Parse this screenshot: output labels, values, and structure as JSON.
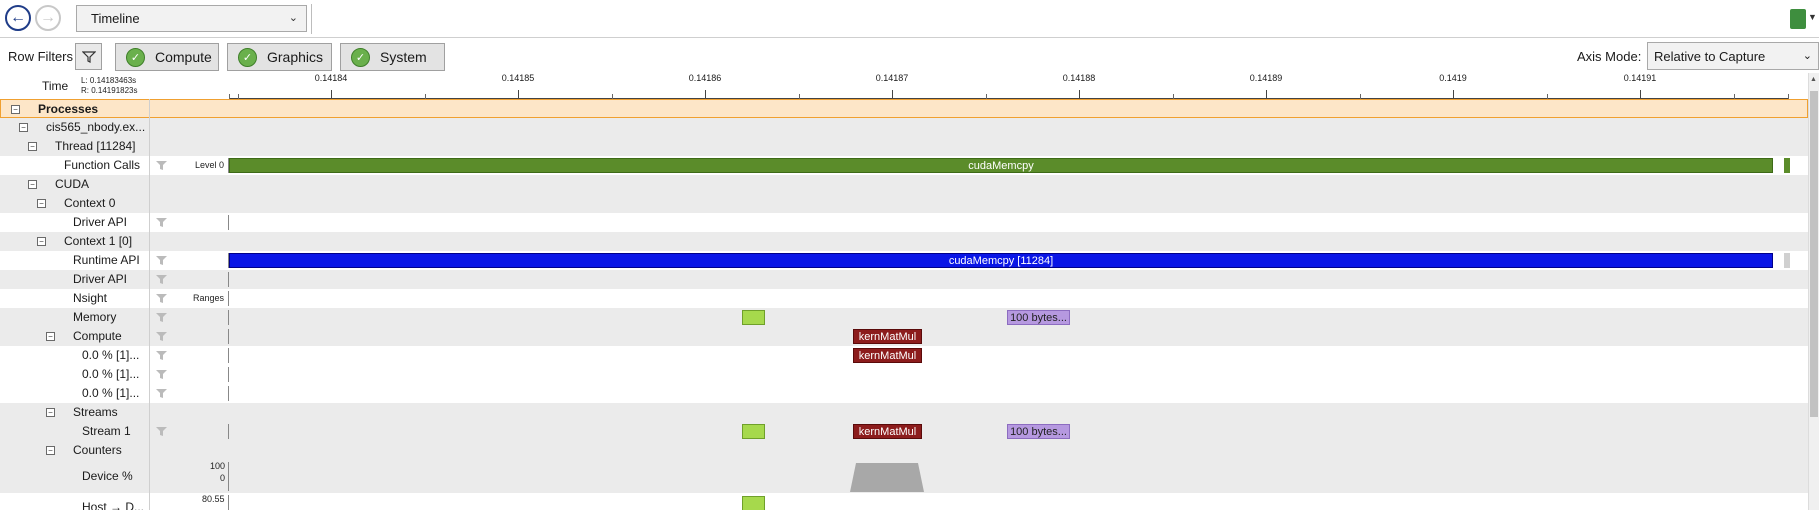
{
  "toolbar": {
    "back_icon": "left-arrow-icon",
    "forward_icon": "right-arrow-icon",
    "view": "Timeline",
    "doc_icon": "document-icon"
  },
  "filters": {
    "row_filters_label": "Row Filters",
    "buttons": [
      "Compute",
      "Graphics",
      "System"
    ],
    "axis_mode_label": "Axis Mode:",
    "axis_mode_value": "Relative to Capture"
  },
  "ruler": {
    "time_label": "Time",
    "left": "L: 0.14183463s",
    "right": "R: 0.14191823s",
    "ticks": [
      "0.14184",
      "0.14185",
      "0.14186",
      "0.14187",
      "0.14188",
      "0.14189",
      "0.1419",
      "0.14191"
    ]
  },
  "rows": {
    "processes": "Processes",
    "process_name": "cis565_nbody.ex...",
    "thread": "Thread [11284]",
    "function_calls": "Function Calls",
    "level_tag": "Level 0",
    "cuda": "CUDA",
    "context0": "Context 0",
    "driver_api_0": "Driver API",
    "context1": "Context 1 [0]",
    "runtime_api": "Runtime API",
    "driver_api_1": "Driver API",
    "nsight": "Nsight",
    "ranges_tag": "Ranges",
    "memory": "Memory",
    "compute": "Compute",
    "compute_sub_1": "0.0 % [1]...",
    "compute_sub_2": "0.0 % [1]...",
    "compute_sub_3": "0.0 % [1]...",
    "streams": "Streams",
    "stream1": "Stream 1",
    "counters": "Counters",
    "device_pct": "Device %",
    "device_max": "100",
    "device_min": "0",
    "host_d": "Host → D...",
    "host_val": "80.55"
  },
  "events": {
    "function_call": "cudaMemcpy",
    "runtime_call": "cudaMemcpy [11284]",
    "kernel": "kernMatMul",
    "memcpy_bytes": "100 bytes..."
  },
  "colors": {
    "function_calls": "#5b8c2a",
    "runtime_api": "#0a16e6",
    "memcpy_htod": "#a6d94c",
    "kernel": "#8c1c1c",
    "memcpy_dtoh": "#b699e0",
    "process_highlight": "#f0a030"
  }
}
